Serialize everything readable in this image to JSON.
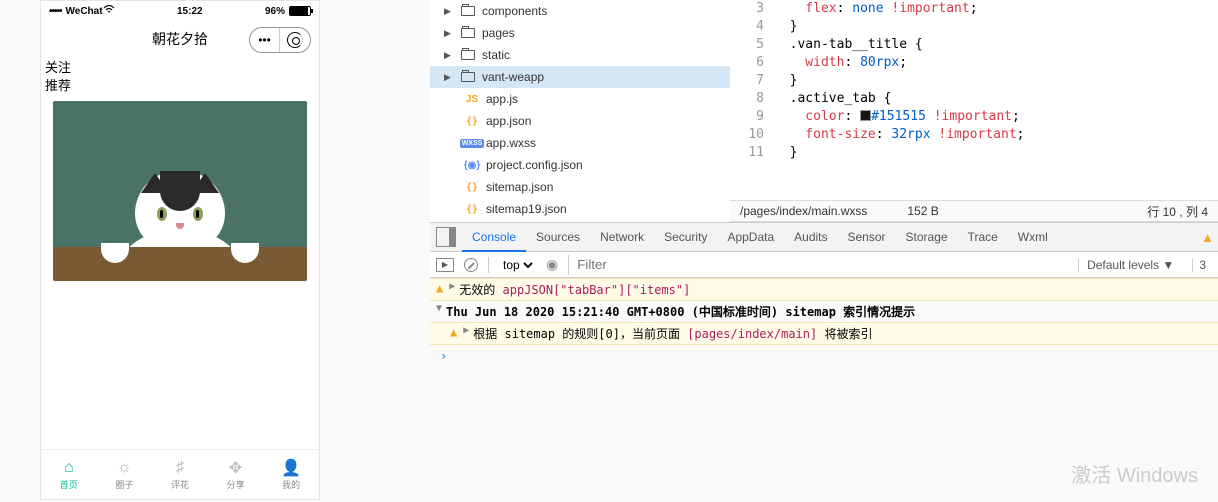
{
  "phone": {
    "carrier": "WeChat",
    "wifi_icon": "wifi",
    "time": "15:22",
    "battery_pct": "96%",
    "title": "朝花夕拾",
    "tabs": {
      "t0": "关注",
      "t1": "推荐"
    },
    "nav": {
      "home": "首页",
      "circle": "圈子",
      "flower": "评花",
      "share": "分享",
      "mine": "我的"
    }
  },
  "tree": {
    "components": "components",
    "pages": "pages",
    "static": "static",
    "vantweapp": "vant-weapp",
    "appjs": "app.js",
    "appjson": "app.json",
    "appwxss": "app.wxss",
    "projectconfig": "project.config.json",
    "sitemap": "sitemap.json",
    "sitemap19": "sitemap19.json",
    "js_badge": "JS",
    "wxss_badge": "WXSS"
  },
  "code": {
    "l3": "    flex: none !important;",
    "l4": "  }",
    "l5": "  .van-tab__title {",
    "l6": "    width: 80rpx;",
    "l7": "  }",
    "l8": "  .active_tab {",
    "l9a": "    color: ",
    "l9b": "#151515",
    "l9c": " !important;",
    "l10": "    font-size: 32rpx !important;",
    "l11": "  }",
    "gut": {
      "n3": "3",
      "n4": "4",
      "n5": "5",
      "n6": "6",
      "n7": "7",
      "n8": "8",
      "n9": "9",
      "n10": "10",
      "n11": "11"
    }
  },
  "edstatus": {
    "path": "/pages/index/main.wxss",
    "size": "152 B",
    "pos": "行 10 , 列 4"
  },
  "devtabs": {
    "console": "Console",
    "sources": "Sources",
    "network": "Network",
    "security": "Security",
    "appdata": "AppData",
    "audits": "Audits",
    "sensor": "Sensor",
    "storage": "Storage",
    "trace": "Trace",
    "wxml": "Wxml"
  },
  "toolbar": {
    "ctx": "top",
    "filter_ph": "Filter",
    "levels": "Default levels ▼",
    "count3": "3"
  },
  "cons": {
    "w1a": "无效的 ",
    "w1b": "appJSON[\"tabBar\"][\"items\"]",
    "g1": "Thu Jun 18 2020 15:21:40 GMT+0800 (中国标准时间) sitemap 索引情况提示",
    "w2a": "根据 sitemap 的规则[0]，当前页面 ",
    "w2b": "[pages/index/main]",
    "w2c": " 将被索引"
  },
  "watermark": {
    "title": "激活 Windows",
    "sub": ""
  }
}
